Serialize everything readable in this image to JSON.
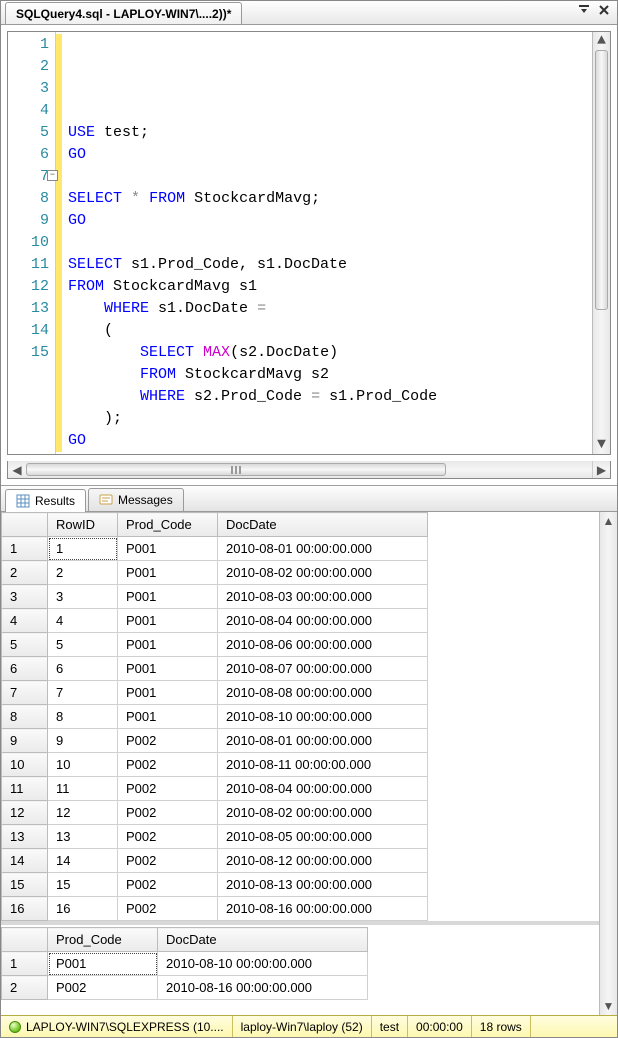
{
  "tab": {
    "title": "SQLQuery4.sql - LAPLOY-WIN7\\....2))*"
  },
  "editor": {
    "line_numbers": [
      "1",
      "2",
      "3",
      "4",
      "5",
      "6",
      "7",
      "8",
      "9",
      "10",
      "11",
      "12",
      "13",
      "14",
      "15"
    ],
    "lines": [
      {
        "segments": [
          {
            "t": "USE",
            "c": "kw"
          },
          {
            "t": " test;",
            "c": "ident"
          }
        ]
      },
      {
        "segments": [
          {
            "t": "GO",
            "c": "kw"
          }
        ]
      },
      {
        "segments": []
      },
      {
        "segments": [
          {
            "t": "SELECT",
            "c": "kw"
          },
          {
            "t": " ",
            "c": ""
          },
          {
            "t": "*",
            "c": "star"
          },
          {
            "t": " ",
            "c": ""
          },
          {
            "t": "FROM",
            "c": "kw"
          },
          {
            "t": " StockcardMavg;",
            "c": "ident"
          }
        ]
      },
      {
        "segments": [
          {
            "t": "GO",
            "c": "kw"
          }
        ]
      },
      {
        "segments": []
      },
      {
        "segments": [
          {
            "t": "SELECT",
            "c": "kw"
          },
          {
            "t": " s1.Prod_Code, s1.DocDate",
            "c": "ident"
          }
        ]
      },
      {
        "segments": [
          {
            "t": "FROM",
            "c": "kw"
          },
          {
            "t": " StockcardMavg s1",
            "c": "ident"
          }
        ]
      },
      {
        "segments": [
          {
            "t": "    ",
            "c": ""
          },
          {
            "t": "WHERE",
            "c": "kw"
          },
          {
            "t": " s1.DocDate ",
            "c": "ident"
          },
          {
            "t": "=",
            "c": "star"
          }
        ]
      },
      {
        "segments": [
          {
            "t": "    (",
            "c": "ident"
          }
        ]
      },
      {
        "segments": [
          {
            "t": "        ",
            "c": ""
          },
          {
            "t": "SELECT",
            "c": "kw"
          },
          {
            "t": " ",
            "c": ""
          },
          {
            "t": "MAX",
            "c": "fn"
          },
          {
            "t": "(s2.DocDate)",
            "c": "ident"
          }
        ]
      },
      {
        "segments": [
          {
            "t": "        ",
            "c": ""
          },
          {
            "t": "FROM",
            "c": "kw"
          },
          {
            "t": " StockcardMavg s2",
            "c": "ident"
          }
        ]
      },
      {
        "segments": [
          {
            "t": "        ",
            "c": ""
          },
          {
            "t": "WHERE",
            "c": "kw"
          },
          {
            "t": " s2.Prod_Code ",
            "c": "ident"
          },
          {
            "t": "=",
            "c": "star"
          },
          {
            "t": " s1.Prod_Code",
            "c": "ident"
          }
        ]
      },
      {
        "segments": [
          {
            "t": "    );",
            "c": "ident"
          }
        ]
      },
      {
        "segments": [
          {
            "t": "GO",
            "c": "kw"
          }
        ]
      }
    ]
  },
  "result_tabs": {
    "results": "Results",
    "messages": "Messages"
  },
  "grid1": {
    "headers": [
      "RowID",
      "Prod_Code",
      "DocDate"
    ],
    "rows": [
      [
        "1",
        "P001",
        "2010-08-01 00:00:00.000"
      ],
      [
        "2",
        "P001",
        "2010-08-02 00:00:00.000"
      ],
      [
        "3",
        "P001",
        "2010-08-03 00:00:00.000"
      ],
      [
        "4",
        "P001",
        "2010-08-04 00:00:00.000"
      ],
      [
        "5",
        "P001",
        "2010-08-06 00:00:00.000"
      ],
      [
        "6",
        "P001",
        "2010-08-07 00:00:00.000"
      ],
      [
        "7",
        "P001",
        "2010-08-08 00:00:00.000"
      ],
      [
        "8",
        "P001",
        "2010-08-10 00:00:00.000"
      ],
      [
        "9",
        "P002",
        "2010-08-01 00:00:00.000"
      ],
      [
        "10",
        "P002",
        "2010-08-11 00:00:00.000"
      ],
      [
        "11",
        "P002",
        "2010-08-04 00:00:00.000"
      ],
      [
        "12",
        "P002",
        "2010-08-02 00:00:00.000"
      ],
      [
        "13",
        "P002",
        "2010-08-05 00:00:00.000"
      ],
      [
        "14",
        "P002",
        "2010-08-12 00:00:00.000"
      ],
      [
        "15",
        "P002",
        "2010-08-13 00:00:00.000"
      ],
      [
        "16",
        "P002",
        "2010-08-16 00:00:00.000"
      ]
    ]
  },
  "grid2": {
    "headers": [
      "Prod_Code",
      "DocDate"
    ],
    "rows": [
      [
        "P001",
        "2010-08-10 00:00:00.000"
      ],
      [
        "P002",
        "2010-08-16 00:00:00.000"
      ]
    ]
  },
  "status": {
    "server": "LAPLOY-WIN7\\SQLEXPRESS (10....",
    "user": "laploy-Win7\\laploy (52)",
    "db": "test",
    "time": "00:00:00",
    "rows": "18 rows"
  }
}
